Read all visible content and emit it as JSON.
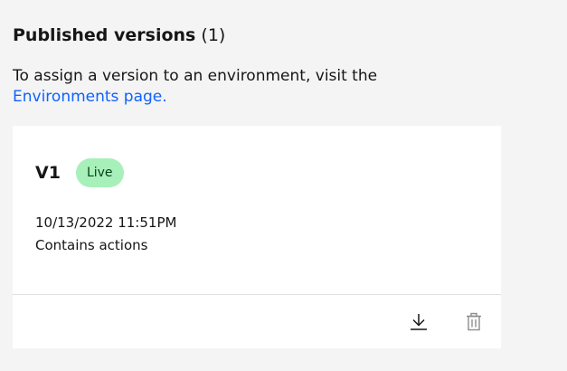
{
  "section": {
    "title": "Published versions",
    "count": "(1)",
    "description_prefix": "To assign a version to an environment, visit the",
    "environments_link": "Environments page."
  },
  "versions": [
    {
      "name": "V1",
      "status": "Live",
      "status_color": "#a7f0ba",
      "date": "10/13/2022 11:51PM",
      "contents": "Contains actions",
      "actions": [
        {
          "icon": "download-icon"
        },
        {
          "icon": "trash-icon"
        }
      ]
    }
  ],
  "colors": {
    "background": "#f4f4f4",
    "card": "#ffffff",
    "link": "#0f62fe",
    "divider": "#e0e0e0",
    "delete_icon": "#8d8d8d"
  }
}
